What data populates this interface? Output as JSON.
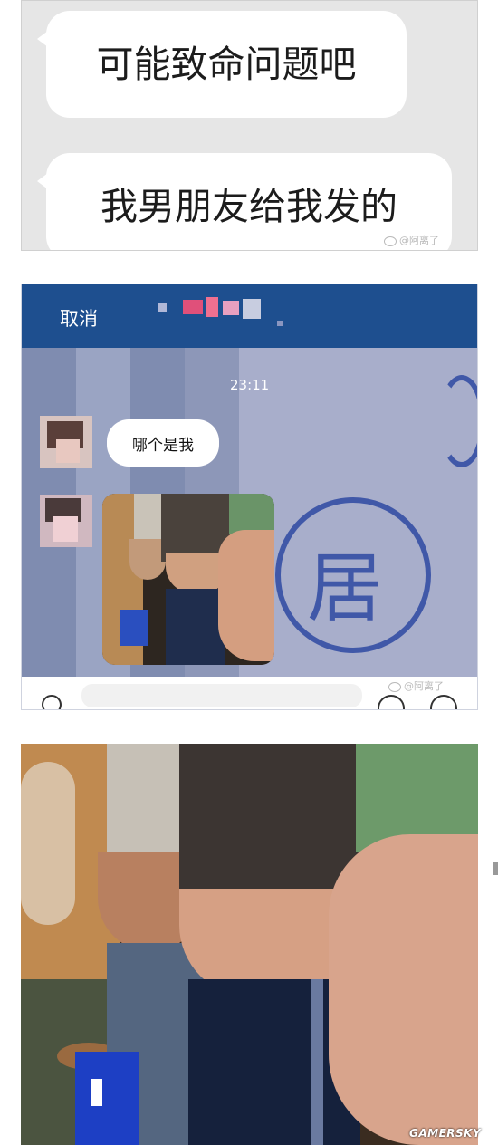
{
  "panel1": {
    "bubble_1": "可能致命问题吧",
    "bubble_2": "我男朋友给我发的",
    "watermark": "@阿离了"
  },
  "panel2": {
    "header": {
      "cancel_label": "取消"
    },
    "timestamp": "23:11",
    "message": "哪个是我",
    "seal_char": "居",
    "watermark": "@阿离了",
    "icons": [
      "emoji-icon",
      "add-icon",
      "voice-icon"
    ]
  },
  "panel3": {
    "caption": ""
  },
  "site_watermark": "GAMERSKY"
}
